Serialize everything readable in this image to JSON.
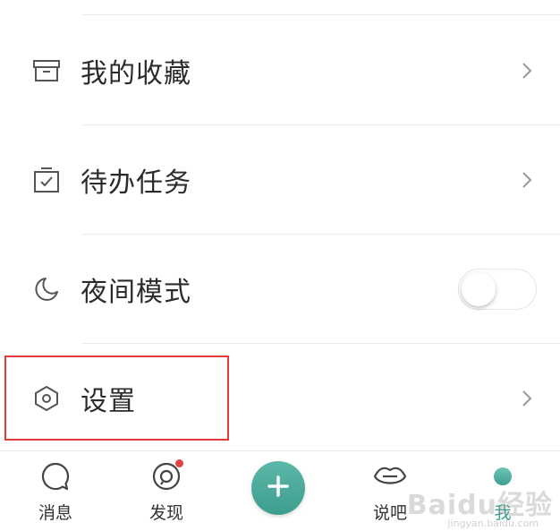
{
  "menu": {
    "items": [
      {
        "label": "我的收藏",
        "icon": "favorites-box-icon",
        "control": "chevron"
      },
      {
        "label": "待办任务",
        "icon": "todo-check-icon",
        "control": "chevron"
      },
      {
        "label": "夜间模式",
        "icon": "moon-icon",
        "control": "toggle",
        "toggle_on": false
      },
      {
        "label": "设置",
        "icon": "hexagon-settings-icon",
        "control": "chevron"
      }
    ]
  },
  "tabbar": {
    "tabs": [
      {
        "label": "消息",
        "icon": "message-bubble-icon"
      },
      {
        "label": "发现",
        "icon": "discover-icon",
        "badge": true
      },
      {
        "label": "",
        "icon": "plus-icon"
      },
      {
        "label": "说吧",
        "icon": "lips-icon"
      },
      {
        "label": "我",
        "icon": "me-dot-icon",
        "active": true
      }
    ]
  },
  "watermark": {
    "text": "Baidu经验",
    "sub": "jingyan.baidu.com"
  },
  "colors": {
    "accent": "#3e9d8e",
    "highlight": "#e03a3a",
    "badge": "#e04444"
  }
}
